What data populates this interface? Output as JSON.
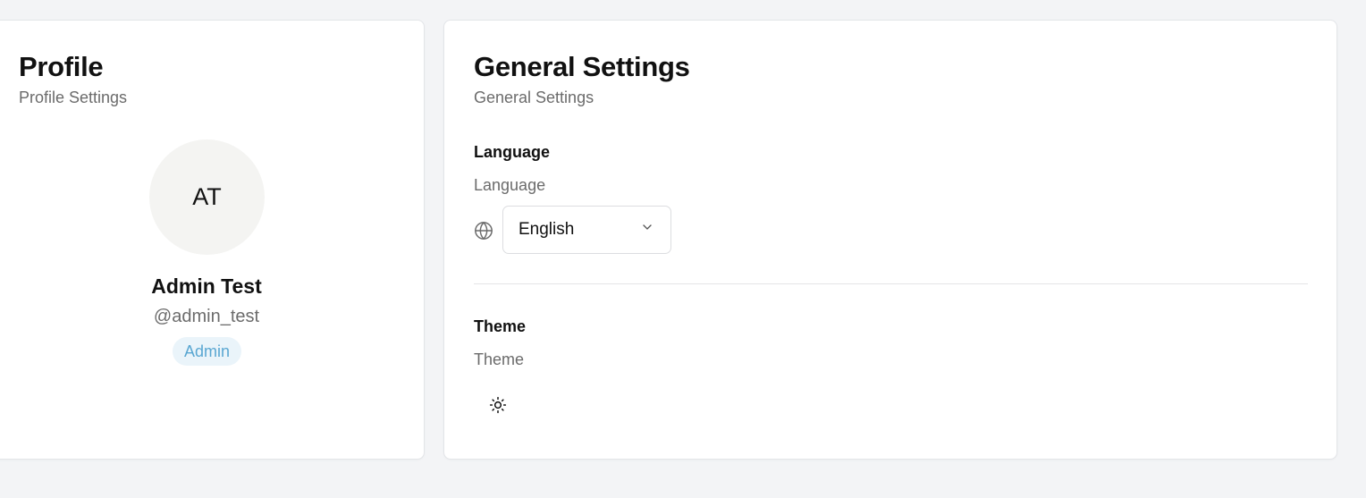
{
  "profile": {
    "title": "Profile",
    "subtitle": "Profile Settings",
    "avatar_initials": "AT",
    "name": "Admin Test",
    "username": "@admin_test",
    "role": "Admin"
  },
  "settings": {
    "title": "General Settings",
    "subtitle": "General Settings",
    "language": {
      "label": "Language",
      "description": "Language",
      "selected": "English",
      "icon": "globe-icon"
    },
    "theme": {
      "label": "Theme",
      "description": "Theme",
      "icon": "sun-icon"
    }
  },
  "colors": {
    "background": "#f3f4f6",
    "card": "#ffffff",
    "badge_bg": "#eaf4fa",
    "badge_text": "#5aa7d2",
    "muted_text": "#6b6b6b"
  }
}
